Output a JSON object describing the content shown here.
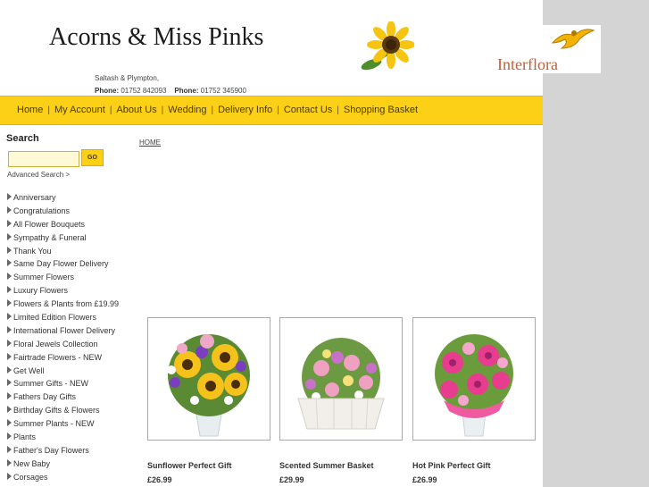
{
  "header": {
    "shop_name": "Acorns & Miss Pinks",
    "locations": "Saltash & Plympton,",
    "phone_label_1": "Phone:",
    "phone_1": "01752 842093",
    "phone_label_2": "Phone:",
    "phone_2": "01752 345900",
    "partner_logo": "Interflora"
  },
  "nav": {
    "items": [
      {
        "label": "Home"
      },
      {
        "label": "My Account"
      },
      {
        "label": "About Us"
      },
      {
        "label": "Wedding"
      },
      {
        "label": "Delivery Info"
      },
      {
        "label": "Contact Us"
      },
      {
        "label": "Shopping Basket"
      }
    ],
    "separator": "|"
  },
  "sidebar": {
    "search_heading": "Search",
    "search_value": "",
    "go_label": "GO",
    "advanced_search": "Advanced Search >",
    "categories": [
      "Anniversary",
      "Congratulations",
      "All Flower Bouquets",
      "Sympathy & Funeral",
      "Thank You",
      "Same Day Flower Delivery",
      "Summer Flowers",
      "Luxury Flowers",
      "Flowers & Plants from £19.99",
      "Limited Edition Flowers",
      "International Flower Delivery",
      "Floral Jewels Collection",
      "Fairtrade Flowers - NEW",
      "Get Well",
      "Summer Gifts - NEW",
      "Fathers Day Gifts",
      "Birthday Gifts & Flowers",
      "Summer Plants - NEW",
      "Plants",
      "Father's Day Flowers",
      "New Baby",
      "Corsages"
    ]
  },
  "breadcrumb": "HOME",
  "products": [
    {
      "name": "Sunflower Perfect Gift",
      "price": "£26.99"
    },
    {
      "name": "Scented Summer Basket",
      "price": "£29.99"
    },
    {
      "name": "Hot Pink Perfect Gift",
      "price": "£26.99"
    }
  ],
  "colors": {
    "nav_bar": "#fdd018",
    "right_rail": "#d4d4d4"
  }
}
